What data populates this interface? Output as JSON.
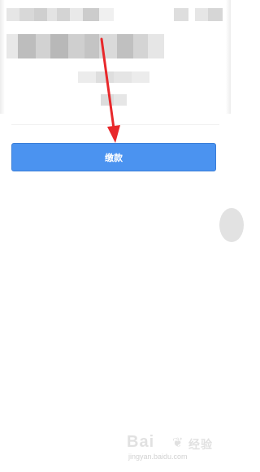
{
  "pay_button": {
    "label": "缴款"
  },
  "watermark": {
    "brand": "Bai",
    "site": "jingyan.baidu.com",
    "suffix": "经验"
  },
  "colors": {
    "accent": "#4b93f0",
    "arrow": "#e8282b"
  }
}
